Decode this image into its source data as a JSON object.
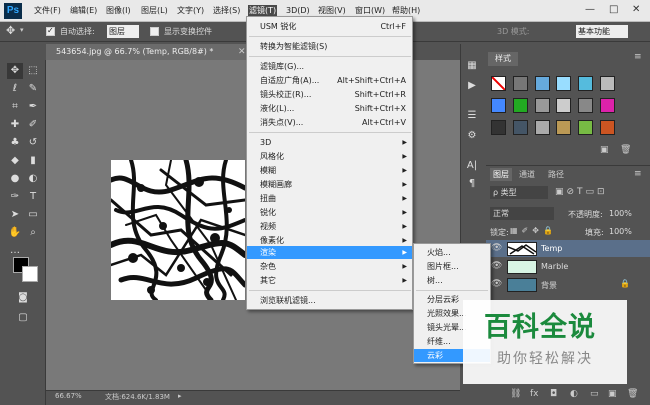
{
  "app": {
    "logo": "Ps"
  },
  "menubar": {
    "items": [
      "文件(F)",
      "编辑(E)",
      "图像(I)",
      "图层(L)",
      "文字(Y)",
      "选择(S)",
      "滤镜(T)",
      "3D(D)",
      "视图(V)",
      "窗口(W)",
      "帮助(H)"
    ],
    "window_controls": [
      "—",
      "□",
      "✕"
    ]
  },
  "options_bar": {
    "auto_select_label": "自动选择:",
    "auto_select_value": "图层",
    "show_transform_label": "显示变换控件",
    "mode_3d": "3D 模式:",
    "workspace": "基本功能"
  },
  "document": {
    "tab_title": "543654.jpg @ 66.7% (Temp, RGB/8#) *",
    "zoom": "66.67%",
    "doc_info": "文档:624.6K/1.83M"
  },
  "filter_menu": {
    "items": [
      {
        "label": "USM 锐化",
        "shortcut": "Ctrl+F"
      },
      {
        "label": "转换为智能滤镜(S)"
      },
      {
        "label": "滤镜库(G)..."
      },
      {
        "label": "自适应广角(A)...",
        "shortcut": "Alt+Shift+Ctrl+A"
      },
      {
        "label": "镜头校正(R)...",
        "shortcut": "Shift+Ctrl+R"
      },
      {
        "label": "液化(L)...",
        "shortcut": "Shift+Ctrl+X"
      },
      {
        "label": "消失点(V)...",
        "shortcut": "Alt+Ctrl+V"
      },
      {
        "label": "3D"
      },
      {
        "label": "风格化"
      },
      {
        "label": "模糊"
      },
      {
        "label": "模糊画廊"
      },
      {
        "label": "扭曲"
      },
      {
        "label": "锐化"
      },
      {
        "label": "视频"
      },
      {
        "label": "像素化"
      },
      {
        "label": "渲染"
      },
      {
        "label": "杂色"
      },
      {
        "label": "其它"
      },
      {
        "label": "浏览联机滤镜..."
      }
    ]
  },
  "render_submenu": {
    "items": [
      "火焰...",
      "图片框...",
      "树...",
      "分层云彩",
      "光照效果...",
      "镜头光晕...",
      "纤维...",
      "云彩"
    ]
  },
  "styles_panel": {
    "tab": "样式"
  },
  "layers_panel": {
    "tabs": [
      "图层",
      "通道",
      "路径"
    ],
    "kind_filter": "ρ 类型",
    "blend_mode": "正常",
    "opacity_label": "不透明度:",
    "opacity_value": "100%",
    "lock_label": "锁定:",
    "fill_label": "填充:",
    "fill_value": "100%",
    "layers": [
      {
        "name": "Temp",
        "selected": true
      },
      {
        "name": "Marble",
        "selected": false
      },
      {
        "name": "背景",
        "selected": false,
        "locked": true
      }
    ]
  },
  "watermark": {
    "title": "百科全说",
    "subtitle": "助你轻松解决"
  }
}
